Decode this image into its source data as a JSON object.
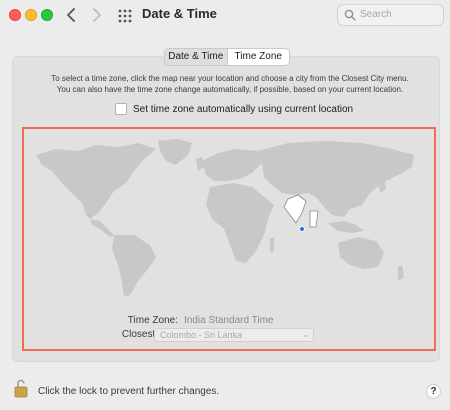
{
  "window": {
    "title": "Date & Time"
  },
  "search": {
    "placeholder": "Search"
  },
  "tabs": [
    {
      "label": "Date & Time",
      "selected": false
    },
    {
      "label": "Time Zone",
      "selected": true
    }
  ],
  "description": {
    "line1": "To select a time zone, click the map near your location and choose a city from the Closest City menu.",
    "line2": "You can also have the time zone change automatically, if possible, based on your current location."
  },
  "auto_timezone": {
    "label": "Set time zone automatically using current location",
    "checked": false
  },
  "time_zone": {
    "label": "Time Zone:",
    "value": "India Standard Time"
  },
  "closest_city": {
    "label": "Closest City:",
    "value": "Colombo - Sri Lanka"
  },
  "footer": {
    "lock_text": "Click the lock to prevent further changes.",
    "help_label": "?"
  },
  "colors": {
    "highlight_border": "#ef6d53",
    "map_land": "#c8c8c8",
    "selected_zone": "#ffffff",
    "location_pin": "#2f6fdc"
  }
}
